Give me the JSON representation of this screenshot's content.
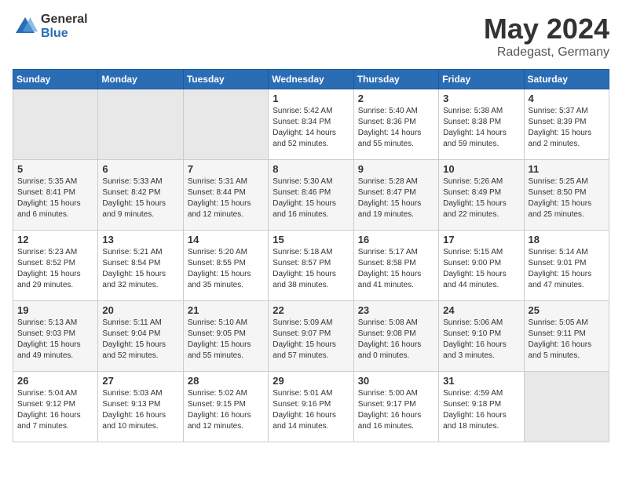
{
  "header": {
    "logo_general": "General",
    "logo_blue": "Blue",
    "title": "May 2024",
    "location": "Radegast, Germany"
  },
  "weekdays": [
    "Sunday",
    "Monday",
    "Tuesday",
    "Wednesday",
    "Thursday",
    "Friday",
    "Saturday"
  ],
  "weeks": [
    [
      {
        "day": "",
        "info": ""
      },
      {
        "day": "",
        "info": ""
      },
      {
        "day": "",
        "info": ""
      },
      {
        "day": "1",
        "info": "Sunrise: 5:42 AM\nSunset: 8:34 PM\nDaylight: 14 hours and 52 minutes."
      },
      {
        "day": "2",
        "info": "Sunrise: 5:40 AM\nSunset: 8:36 PM\nDaylight: 14 hours and 55 minutes."
      },
      {
        "day": "3",
        "info": "Sunrise: 5:38 AM\nSunset: 8:38 PM\nDaylight: 14 hours and 59 minutes."
      },
      {
        "day": "4",
        "info": "Sunrise: 5:37 AM\nSunset: 8:39 PM\nDaylight: 15 hours and 2 minutes."
      }
    ],
    [
      {
        "day": "5",
        "info": "Sunrise: 5:35 AM\nSunset: 8:41 PM\nDaylight: 15 hours and 6 minutes."
      },
      {
        "day": "6",
        "info": "Sunrise: 5:33 AM\nSunset: 8:42 PM\nDaylight: 15 hours and 9 minutes."
      },
      {
        "day": "7",
        "info": "Sunrise: 5:31 AM\nSunset: 8:44 PM\nDaylight: 15 hours and 12 minutes."
      },
      {
        "day": "8",
        "info": "Sunrise: 5:30 AM\nSunset: 8:46 PM\nDaylight: 15 hours and 16 minutes."
      },
      {
        "day": "9",
        "info": "Sunrise: 5:28 AM\nSunset: 8:47 PM\nDaylight: 15 hours and 19 minutes."
      },
      {
        "day": "10",
        "info": "Sunrise: 5:26 AM\nSunset: 8:49 PM\nDaylight: 15 hours and 22 minutes."
      },
      {
        "day": "11",
        "info": "Sunrise: 5:25 AM\nSunset: 8:50 PM\nDaylight: 15 hours and 25 minutes."
      }
    ],
    [
      {
        "day": "12",
        "info": "Sunrise: 5:23 AM\nSunset: 8:52 PM\nDaylight: 15 hours and 29 minutes."
      },
      {
        "day": "13",
        "info": "Sunrise: 5:21 AM\nSunset: 8:54 PM\nDaylight: 15 hours and 32 minutes."
      },
      {
        "day": "14",
        "info": "Sunrise: 5:20 AM\nSunset: 8:55 PM\nDaylight: 15 hours and 35 minutes."
      },
      {
        "day": "15",
        "info": "Sunrise: 5:18 AM\nSunset: 8:57 PM\nDaylight: 15 hours and 38 minutes."
      },
      {
        "day": "16",
        "info": "Sunrise: 5:17 AM\nSunset: 8:58 PM\nDaylight: 15 hours and 41 minutes."
      },
      {
        "day": "17",
        "info": "Sunrise: 5:15 AM\nSunset: 9:00 PM\nDaylight: 15 hours and 44 minutes."
      },
      {
        "day": "18",
        "info": "Sunrise: 5:14 AM\nSunset: 9:01 PM\nDaylight: 15 hours and 47 minutes."
      }
    ],
    [
      {
        "day": "19",
        "info": "Sunrise: 5:13 AM\nSunset: 9:03 PM\nDaylight: 15 hours and 49 minutes."
      },
      {
        "day": "20",
        "info": "Sunrise: 5:11 AM\nSunset: 9:04 PM\nDaylight: 15 hours and 52 minutes."
      },
      {
        "day": "21",
        "info": "Sunrise: 5:10 AM\nSunset: 9:05 PM\nDaylight: 15 hours and 55 minutes."
      },
      {
        "day": "22",
        "info": "Sunrise: 5:09 AM\nSunset: 9:07 PM\nDaylight: 15 hours and 57 minutes."
      },
      {
        "day": "23",
        "info": "Sunrise: 5:08 AM\nSunset: 9:08 PM\nDaylight: 16 hours and 0 minutes."
      },
      {
        "day": "24",
        "info": "Sunrise: 5:06 AM\nSunset: 9:10 PM\nDaylight: 16 hours and 3 minutes."
      },
      {
        "day": "25",
        "info": "Sunrise: 5:05 AM\nSunset: 9:11 PM\nDaylight: 16 hours and 5 minutes."
      }
    ],
    [
      {
        "day": "26",
        "info": "Sunrise: 5:04 AM\nSunset: 9:12 PM\nDaylight: 16 hours and 7 minutes."
      },
      {
        "day": "27",
        "info": "Sunrise: 5:03 AM\nSunset: 9:13 PM\nDaylight: 16 hours and 10 minutes."
      },
      {
        "day": "28",
        "info": "Sunrise: 5:02 AM\nSunset: 9:15 PM\nDaylight: 16 hours and 12 minutes."
      },
      {
        "day": "29",
        "info": "Sunrise: 5:01 AM\nSunset: 9:16 PM\nDaylight: 16 hours and 14 minutes."
      },
      {
        "day": "30",
        "info": "Sunrise: 5:00 AM\nSunset: 9:17 PM\nDaylight: 16 hours and 16 minutes."
      },
      {
        "day": "31",
        "info": "Sunrise: 4:59 AM\nSunset: 9:18 PM\nDaylight: 16 hours and 18 minutes."
      },
      {
        "day": "",
        "info": ""
      }
    ]
  ]
}
